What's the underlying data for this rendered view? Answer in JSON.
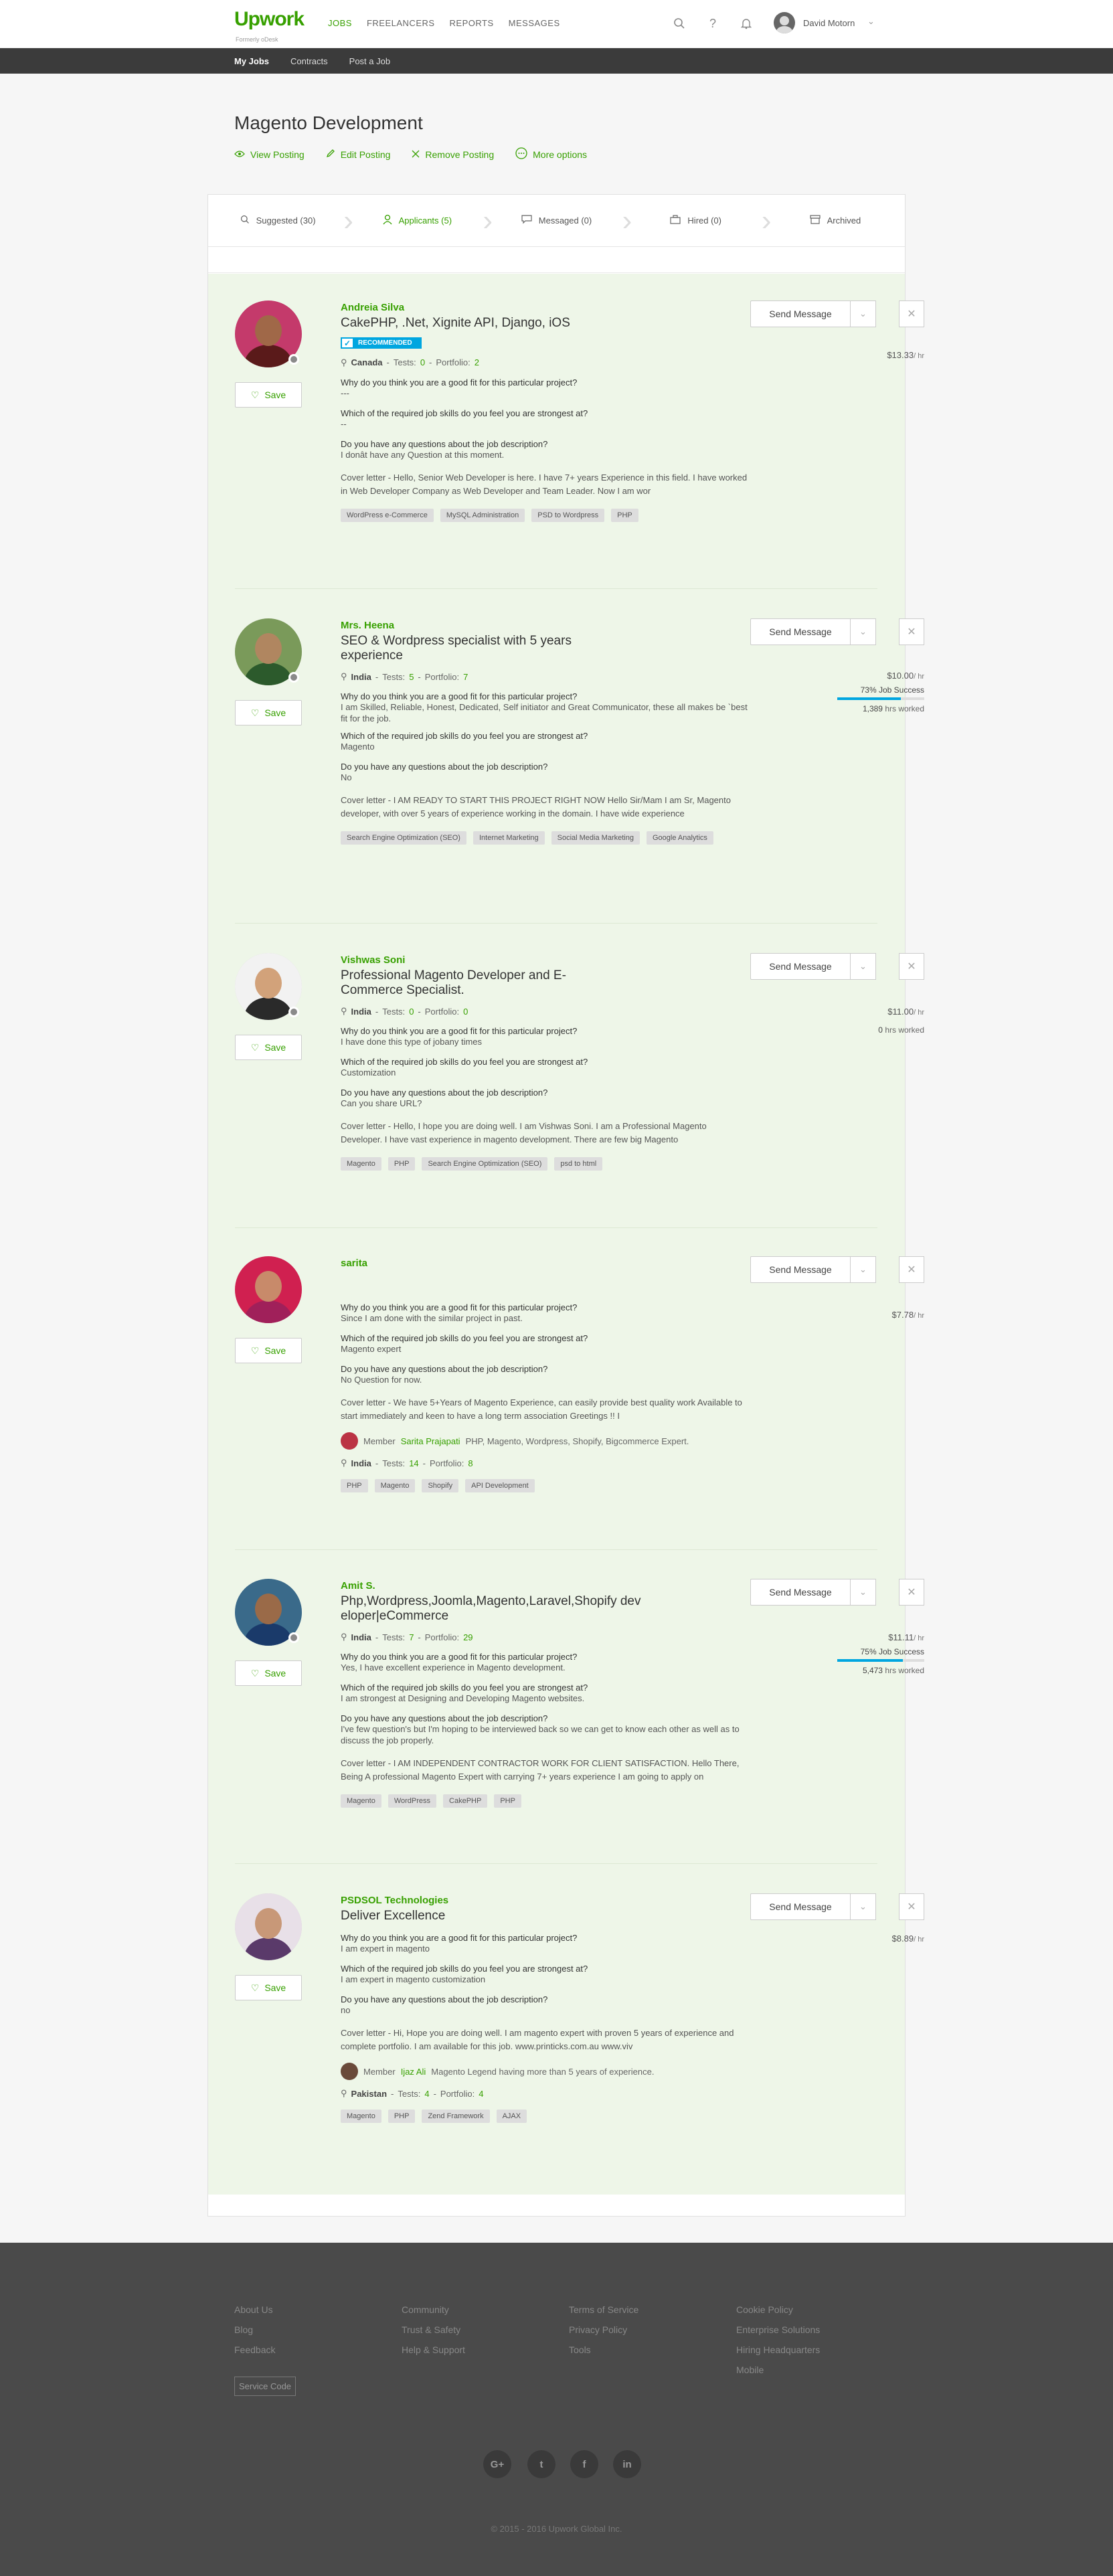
{
  "brand": {
    "name": "Upwork",
    "tagline": "Formerly oDesk"
  },
  "topnav": {
    "items": [
      "JOBS",
      "FREELANCERS",
      "REPORTS",
      "MESSAGES"
    ],
    "user_name": "David Motorn"
  },
  "subnav": {
    "items": [
      "My Jobs",
      "Contracts",
      "Post a Job"
    ]
  },
  "page": {
    "title": "Magento Development",
    "actions": [
      "View Posting",
      "Edit Posting",
      "Remove Posting",
      "More options"
    ]
  },
  "tabs": [
    {
      "label": "Suggested (30)"
    },
    {
      "label": "Applicants (5)"
    },
    {
      "label": "Messaged (0)"
    },
    {
      "label": "Hired (0)"
    },
    {
      "label": "Archived"
    }
  ],
  "labels": {
    "save": "Save",
    "send_message": "Send Message",
    "recommended": "RECOMMENDED",
    "q1": "Why do you think you are a good fit for this particular project?",
    "q2": "Which of the required job skills do you feel you are strongest at?",
    "q3": "Do you have any questions about the job description?",
    "rate_suffix": "/ hr",
    "tests_label": "Tests:",
    "portfolio_label": "Portfolio:",
    "member_label": "Member",
    "hrs_worked_label": "hrs worked"
  },
  "applicants": [
    {
      "name": "Andreia Silva",
      "title": "CakePHP, .Net, Xignite API, Django, iOS",
      "recommended": true,
      "country": "Canada",
      "tests": "0",
      "portfolio": "2",
      "a1": "---",
      "a2": "--",
      "a3": "I donât have any Question at this moment.",
      "cover": "Cover letter - Hello, Senior Web Developer is here. I have 7+ years Experience in this field. I have worked in Web Developer Company as Web Developer and Team Leader. Now I am wor",
      "skills": [
        "WordPress e-Commerce",
        "MySQL Administration",
        "PSD to Wordpress",
        "PHP"
      ],
      "rate": "$13.33",
      "photo_face": "#a06848",
      "photo_body": "#5a1a1a",
      "photo_bg": "#c43a6b"
    },
    {
      "name": "Mrs. Heena",
      "title": "SEO & Wordpress specialist with 5 years experience",
      "country": "India",
      "tests": "5",
      "portfolio": "7",
      "a1": "I am Skilled, Reliable, Honest, Dedicated, Self initiator and Great Communicator, these all makes be `best fit for the job.",
      "a2": "Magento",
      "a3": "No",
      "cover": "Cover letter - I AM READY TO START THIS PROJECT RIGHT NOW Hello Sir/Mam I am Sr, Magento developer, with over 5 years of experience working in the domain. I have wide experience",
      "skills": [
        "Search Engine Optimization (SEO)",
        "Internet Marketing",
        "Social Media Marketing",
        "Google Analytics"
      ],
      "rate": "$10.00",
      "job_success": "73% Job Success",
      "job_success_pct": 73,
      "hours": "1,389",
      "photo_face": "#b08660",
      "photo_body": "#2c5a2c",
      "photo_bg": "#7a9a5a"
    },
    {
      "name": "Vishwas Soni",
      "title": "Professional Magento Developer and E-Commerce Specialist.",
      "country": "India",
      "tests": "0",
      "portfolio": "0",
      "a1": "I have done this type of jobany times",
      "a2": "Customization",
      "a3": "Can you share URL?",
      "cover": "Cover letter - Hello, I hope you are doing well. I am Vishwas Soni. I am a Professional Magento Developer. I have vast experience in magento development. There are few big Magento",
      "skills": [
        "Magento",
        "PHP",
        "Search Engine Optimization (SEO)",
        "psd to html"
      ],
      "rate": "$11.00",
      "hours": "0",
      "photo_face": "#d2a27a",
      "photo_body": "#2a2a2a",
      "photo_bg": "#f2f2f2"
    },
    {
      "name": "sarita",
      "title": "",
      "a1": "Since I am done with the similar project in past.",
      "a2": "Magento expert",
      "a3": "No Question for now.",
      "cover": "Cover letter - We have 5+Years of Magento Experience, can easily provide best quality work Available to start immediately and keen to have a long term association Greetings !! I",
      "member_name": "Sarita Prajapati",
      "member_desc": "PHP, Magento, Wordpress, Shopify, Bigcommerce Expert.",
      "country": "India",
      "tests": "14",
      "portfolio": "8",
      "skills": [
        "PHP",
        "Magento",
        "Shopify",
        "API Development"
      ],
      "rate": "$7.78",
      "photo_face": "#c88a6a",
      "photo_body": "#a0205a",
      "photo_bg": "#d02050"
    },
    {
      "name": "Amit S.",
      "title": "Php,Wordpress,Joomla,Magento,Laravel,Shopify developer|eCommerce",
      "country": "India",
      "tests": "7",
      "portfolio": "29",
      "a1": "Yes, I have excellent experience in Magento development.",
      "a2": "I am strongest at Designing and Developing Magento websites.",
      "a3": "I've few question's but I'm hoping to be interviewed back so we can get to know each other as well as to discuss the job properly.",
      "cover": "Cover letter - I AM INDEPENDENT CONTRACTOR WORK FOR CLIENT SATISFACTION. Hello There, Being A professional Magento Expert with carrying 7+ years experience I am going to apply on",
      "skills": [
        "Magento",
        "WordPress",
        "CakePHP",
        "PHP"
      ],
      "rate": "$11.11",
      "job_success": "75% Job Success",
      "job_success_pct": 75,
      "hours": "5,473",
      "photo_face": "#9a6a48",
      "photo_body": "#1a3a6a",
      "photo_bg": "#3a6a8a"
    },
    {
      "name": "PSDSOL Technologies",
      "title": "Deliver Excellence",
      "a1": "I am expert in magento",
      "a2": "I am expert in magento customization",
      "a3": "no",
      "cover": "Cover letter - Hi, Hope you are doing well. I am magento expert with proven 5 years of experience and complete portfolio. I am available for this job. www.printicks.com.au www.viv",
      "member_name": "Ijaz Ali",
      "member_desc": "Magento Legend having more than 5 years of experience.",
      "country": "Pakistan",
      "tests": "4",
      "portfolio": "4",
      "skills": [
        "Magento",
        "PHP",
        "Zend Framework",
        "AJAX"
      ],
      "rate": "$8.89",
      "photo_face": "#c89878",
      "photo_body": "#5a3a6a",
      "photo_bg": "#e8e0e8"
    }
  ],
  "footer": {
    "col1": [
      "About Us",
      "Blog",
      "Feedback"
    ],
    "col2": [
      "Community",
      "Trust & Safety",
      "Help & Support"
    ],
    "col3": [
      "Terms of Service",
      "Privacy Policy",
      "Tools"
    ],
    "col4": [
      "Cookie Policy",
      "Enterprise Solutions",
      "Hiring Headquarters",
      "Mobile"
    ],
    "service_code": "Service Code",
    "social": [
      "G+",
      "t",
      "f",
      "in"
    ],
    "copyright": "© 2015 - 2016 Upwork Global Inc."
  },
  "colors": {
    "accent": "#37a000",
    "info": "#00a6e0",
    "subnav_bg": "#3b3b3b",
    "footer_bg": "#4a4a4a",
    "card_bg": "#eef6e8"
  }
}
